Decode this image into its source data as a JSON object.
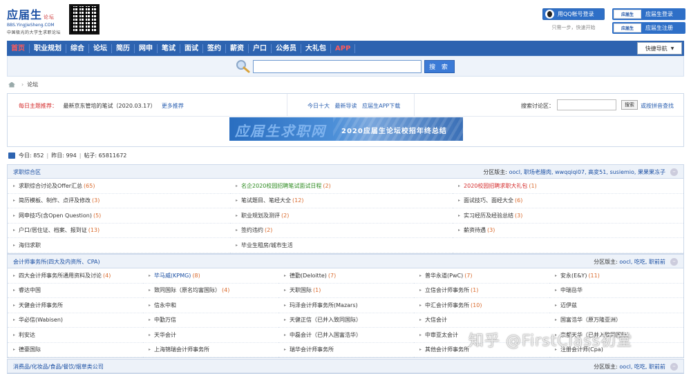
{
  "header": {
    "logo_text": "应届生",
    "logo_tag": "论坛",
    "logo_url_text": "BBS.YingJieSheng.COM",
    "logo_slogan": "中国极光的大学生求职论坛",
    "qq_login_label": "用QQ帐号登录",
    "qq_hint": "只需一步，快速开始",
    "site_login_tag": "应届生",
    "site_login_label": "应届生登录",
    "site_register_tag": "应届生",
    "site_register_label": "应届生注册"
  },
  "nav": {
    "items": [
      {
        "label": "首页",
        "red": true
      },
      {
        "label": "职业规划",
        "red": false
      },
      {
        "label": "综合",
        "red": false
      },
      {
        "label": "论坛",
        "red": false
      },
      {
        "label": "简历",
        "red": false
      },
      {
        "label": "网申",
        "red": false
      },
      {
        "label": "笔试",
        "red": false
      },
      {
        "label": "面试",
        "red": false
      },
      {
        "label": "签约",
        "red": false
      },
      {
        "label": "薪资",
        "red": false
      },
      {
        "label": "户口",
        "red": false
      },
      {
        "label": "公务员",
        "red": false
      },
      {
        "label": "大礼包",
        "red": false
      },
      {
        "label": "APP",
        "red": true
      }
    ],
    "quick_nav_label": "快捷导航"
  },
  "search": {
    "placeholder": "",
    "button_label": "搜 索"
  },
  "breadcrumb": {
    "current": "论坛"
  },
  "recommend": {
    "label": "每日主题推荐：",
    "topic": "最新京东管培的笔试（2020.03.17）",
    "more": "更多推荐",
    "links": [
      "今日十大",
      "最新导读",
      "应届生APP下载"
    ],
    "search_label": "搜索讨论区：",
    "search_button": "搜索",
    "pinyin_label": "或按拼音查找",
    "banner_big": "应届生求职网",
    "banner_text": "2020应届生论坛校招年终总结"
  },
  "stats": {
    "today": "今日: 852",
    "yesterday": "昨日: 994",
    "posts": "帖子: 65811672"
  },
  "sections": [
    {
      "title": "求职综合区",
      "moderators_label": "分区版主: ",
      "moderators": "oocl, 职场老腊肉, wwqqiqi07, 高変51, susiemio, 果果果冻子",
      "cells": [
        {
          "name": "求职综合讨论及Offer汇总",
          "count": "(65)",
          "style": ""
        },
        {
          "name": "名企2020校园招聘笔试面试日程",
          "count": "(2)",
          "style": "green"
        },
        {
          "name": "2020校园招聘求职大礼包",
          "count": "(1)",
          "style": "red"
        },
        {
          "name": "简历模板、制作、点评及修改",
          "count": "(3)",
          "style": ""
        },
        {
          "name": "笔试题目、笔经大全",
          "count": "(12)",
          "style": ""
        },
        {
          "name": "面试技巧、面经大全",
          "count": "(6)",
          "style": ""
        },
        {
          "name": "网申技巧(含Open Question)",
          "count": "(5)",
          "style": ""
        },
        {
          "name": "职业规划及测评",
          "count": "(2)",
          "style": ""
        },
        {
          "name": "实习经历及经验总结",
          "count": "(3)",
          "style": ""
        },
        {
          "name": "户口/居住证、档案、报到证",
          "count": "(13)",
          "style": ""
        },
        {
          "name": "签约违约",
          "count": "(2)",
          "style": ""
        },
        {
          "name": "薪资待遇",
          "count": "(3)",
          "style": ""
        },
        {
          "name": "海归求职",
          "count": "",
          "style": ""
        },
        {
          "name": "毕业生租房/城市生活",
          "count": "",
          "style": ""
        },
        {
          "name": "",
          "count": "",
          "style": ""
        }
      ]
    },
    {
      "title": "会计师事务所(四大及内资所、CPA)",
      "moderators_label": "分区版主: ",
      "moderators": "oocl, 吃吃, 职前前",
      "cells": [
        {
          "name": "四大会计师事务所通用资料及讨论",
          "count": "(4)",
          "style": ""
        },
        {
          "name": "毕马威(KPMG)",
          "count": "(8)",
          "style": "blue"
        },
        {
          "name": "德勤(Deloitte)",
          "count": "(7)",
          "style": ""
        },
        {
          "name": "普华永道(PwC)",
          "count": "(7)",
          "style": ""
        },
        {
          "name": "安永(E&Y)",
          "count": "(11)",
          "style": ""
        },
        {
          "name": "睿达中国",
          "count": "",
          "style": ""
        },
        {
          "name": "致同国际（原名均富国际）",
          "count": "(4)",
          "style": ""
        },
        {
          "name": "天职国际",
          "count": "(1)",
          "style": ""
        },
        {
          "name": "立信会计师事务所",
          "count": "(1)",
          "style": ""
        },
        {
          "name": "中瑞岳华",
          "count": "",
          "style": ""
        },
        {
          "name": "天健会计师事务所",
          "count": "",
          "style": ""
        },
        {
          "name": "信永中和",
          "count": "",
          "style": ""
        },
        {
          "name": "玛泽会计师事务所(Mazars)",
          "count": "",
          "style": ""
        },
        {
          "name": "中汇会计师事务所",
          "count": "(10)",
          "style": ""
        },
        {
          "name": "迈伊兹",
          "count": "",
          "style": ""
        },
        {
          "name": "华必信(Wabisen)",
          "count": "",
          "style": ""
        },
        {
          "name": "中勤万信",
          "count": "",
          "style": ""
        },
        {
          "name": "天健正信（已并入致同国际）",
          "count": "",
          "style": ""
        },
        {
          "name": "大信会计",
          "count": "",
          "style": ""
        },
        {
          "name": "国富浩华（原万隆亚洲）",
          "count": "",
          "style": ""
        },
        {
          "name": "利安达",
          "count": "",
          "style": ""
        },
        {
          "name": "天华会计",
          "count": "",
          "style": ""
        },
        {
          "name": "中磊会计（已并入国富浩华）",
          "count": "",
          "style": ""
        },
        {
          "name": "中审亚太会计",
          "count": "",
          "style": ""
        },
        {
          "name": "京都天华（已并入致同国际）",
          "count": "",
          "style": ""
        },
        {
          "name": "德豪国际",
          "count": "",
          "style": ""
        },
        {
          "name": "上海锦瑞会计师事务所",
          "count": "",
          "style": ""
        },
        {
          "name": "瑞华会计师事务所",
          "count": "",
          "style": ""
        },
        {
          "name": "其他会计师事务所",
          "count": "",
          "style": ""
        },
        {
          "name": "注册会计师(Cpa)",
          "count": "",
          "style": ""
        }
      ]
    },
    {
      "title": "消费品/化妆品/食品/餐饮/烟草类公司",
      "moderators_label": "分区版主: ",
      "moderators": "oocl, 吃吃, 职前前",
      "cells": []
    }
  ],
  "watermark": "知乎 @FirstClass初堂"
}
